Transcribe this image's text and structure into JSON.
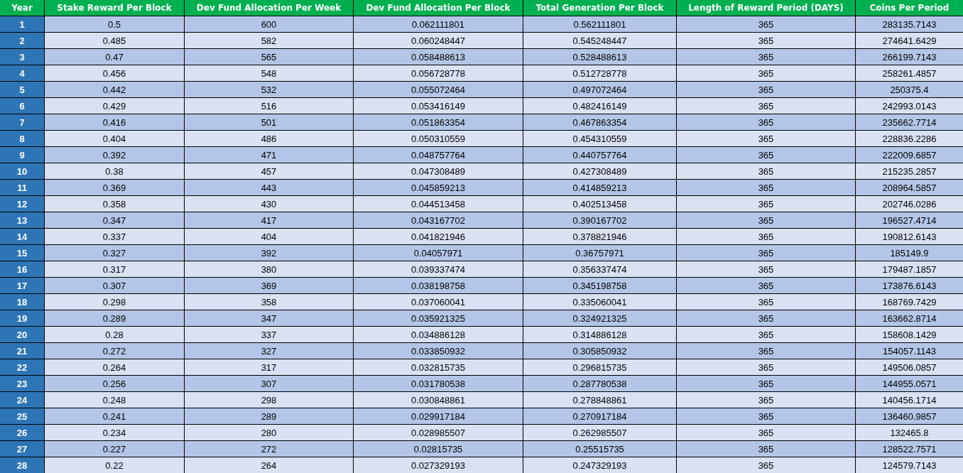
{
  "table": {
    "columns": [
      "Year",
      "Stake Reward Per Block",
      "Dev Fund Allocation Per Week",
      "Dev Fund Allocation Per Block",
      "Total Generation Per Block",
      "Length of Reward Period (DAYS)",
      "Coins Per Period"
    ],
    "rows": [
      [
        "1",
        "0.5",
        "600",
        "0.062111801",
        "0.562111801",
        "365",
        "283135.7143"
      ],
      [
        "2",
        "0.485",
        "582",
        "0.060248447",
        "0.545248447",
        "365",
        "274641.6429"
      ],
      [
        "3",
        "0.47",
        "565",
        "0.058488613",
        "0.528488613",
        "365",
        "266199.7143"
      ],
      [
        "4",
        "0.456",
        "548",
        "0.056728778",
        "0.512728778",
        "365",
        "258261.4857"
      ],
      [
        "5",
        "0.442",
        "532",
        "0.055072464",
        "0.497072464",
        "365",
        "250375.4"
      ],
      [
        "6",
        "0.429",
        "516",
        "0.053416149",
        "0.482416149",
        "365",
        "242993.0143"
      ],
      [
        "7",
        "0.416",
        "501",
        "0.051863354",
        "0.467863354",
        "365",
        "235662.7714"
      ],
      [
        "8",
        "0.404",
        "486",
        "0.050310559",
        "0.454310559",
        "365",
        "228836.2286"
      ],
      [
        "9",
        "0.392",
        "471",
        "0.048757764",
        "0.440757764",
        "365",
        "222009.6857"
      ],
      [
        "10",
        "0.38",
        "457",
        "0.047308489",
        "0.427308489",
        "365",
        "215235.2857"
      ],
      [
        "11",
        "0.369",
        "443",
        "0.045859213",
        "0.414859213",
        "365",
        "208964.5857"
      ],
      [
        "12",
        "0.358",
        "430",
        "0.044513458",
        "0.402513458",
        "365",
        "202746.0286"
      ],
      [
        "13",
        "0.347",
        "417",
        "0.043167702",
        "0.390167702",
        "365",
        "196527.4714"
      ],
      [
        "14",
        "0.337",
        "404",
        "0.041821946",
        "0.378821946",
        "365",
        "190812.6143"
      ],
      [
        "15",
        "0.327",
        "392",
        "0.04057971",
        "0.36757971",
        "365",
        "185149.9"
      ],
      [
        "16",
        "0.317",
        "380",
        "0.039337474",
        "0.356337474",
        "365",
        "179487.1857"
      ],
      [
        "17",
        "0.307",
        "369",
        "0.038198758",
        "0.345198758",
        "365",
        "173876.6143"
      ],
      [
        "18",
        "0.298",
        "358",
        "0.037060041",
        "0.335060041",
        "365",
        "168769.7429"
      ],
      [
        "19",
        "0.289",
        "347",
        "0.035921325",
        "0.324921325",
        "365",
        "163662.8714"
      ],
      [
        "20",
        "0.28",
        "337",
        "0.034886128",
        "0.314886128",
        "365",
        "158608.1429"
      ],
      [
        "21",
        "0.272",
        "327",
        "0.033850932",
        "0.305850932",
        "365",
        "154057.1143"
      ],
      [
        "22",
        "0.264",
        "317",
        "0.032815735",
        "0.296815735",
        "365",
        "149506.0857"
      ],
      [
        "23",
        "0.256",
        "307",
        "0.031780538",
        "0.287780538",
        "365",
        "144955.0571"
      ],
      [
        "24",
        "0.248",
        "298",
        "0.030848861",
        "0.278848861",
        "365",
        "140456.1714"
      ],
      [
        "25",
        "0.241",
        "289",
        "0.029917184",
        "0.270917184",
        "365",
        "136460.9857"
      ],
      [
        "26",
        "0.234",
        "280",
        "0.028985507",
        "0.262985507",
        "365",
        "132465.8"
      ],
      [
        "27",
        "0.227",
        "272",
        "0.02815735",
        "0.25515735",
        "365",
        "128522.7571"
      ],
      [
        "28",
        "0.22",
        "264",
        "0.027329193",
        "0.247329193",
        "365",
        "124579.7143"
      ]
    ]
  }
}
